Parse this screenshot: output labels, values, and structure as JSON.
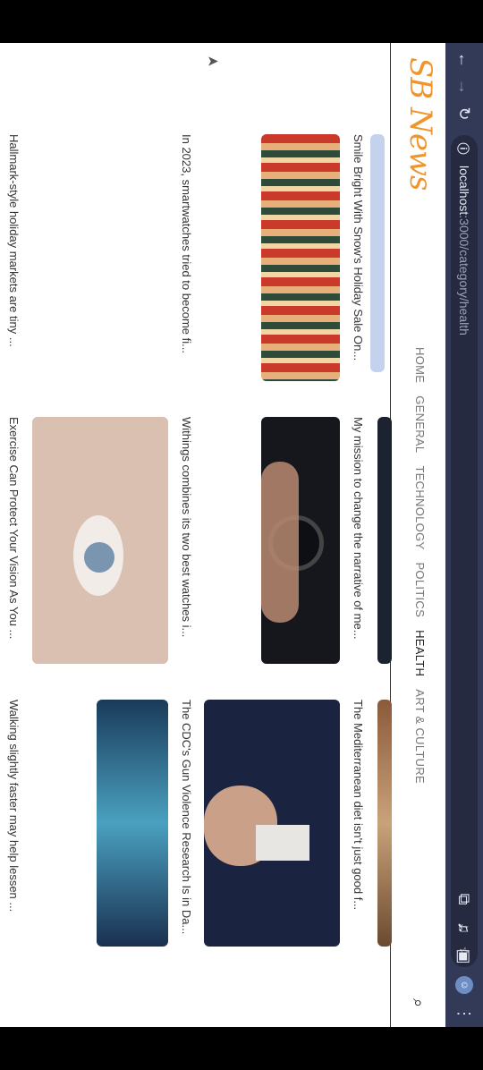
{
  "browser": {
    "url_host": "localhost",
    "url_path": ":3000/category/health",
    "back_icon": "arrow-up-icon",
    "forward_icon": "arrow-down-icon",
    "reload_icon": "reload-icon"
  },
  "site": {
    "logo": "SB News",
    "nav": [
      "HOME",
      "GENERAL",
      "TECHNOLOGY",
      "POLITICS",
      "HEALTH",
      "ART & CULTURE"
    ],
    "active_nav": "HEALTH"
  },
  "articles": [
    {
      "title": "Smile Bright With Snow's Holiday Sale On..."
    },
    {
      "title": "My mission to change the narrative of me..."
    },
    {
      "title": "The Mediterranean diet isn't just good f..."
    },
    {
      "title": "In 2023, smartwatches tried to become fi..."
    },
    {
      "title": "Withings combines its two best watches i..."
    },
    {
      "title": "The CDC's Gun Violence Research Is in Da..."
    },
    {
      "title": "Hallmark-style holiday markets are tiny ..."
    },
    {
      "title": "Exercise Can Protect Your Vision As You ..."
    },
    {
      "title": "Walking slightly faster may help lessen ..."
    }
  ],
  "colors": {
    "chrome": "#333a57",
    "logo": "#f0952c",
    "highlight": "#c4d2ee"
  }
}
